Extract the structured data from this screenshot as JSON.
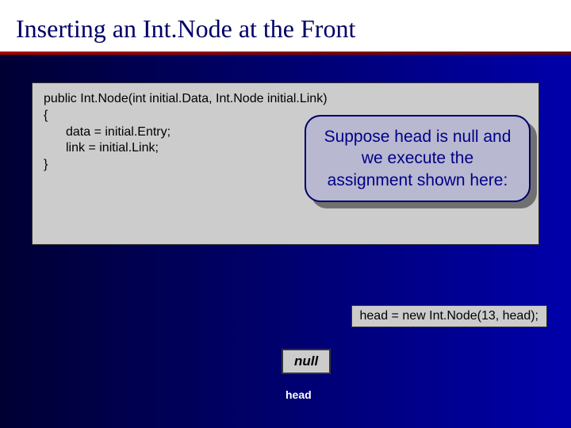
{
  "title": "Inserting an Int.Node at the Front",
  "code": {
    "line1": "public Int.Node(int initial.Data, Int.Node initial.Link)",
    "line2": "{",
    "line3": "data = initial.Entry;",
    "line4": "link = initial.Link;",
    "line5": "}"
  },
  "callout": "Suppose head is null and we execute the assignment shown here:",
  "assignment": "head = new Int.Node(13, head);",
  "nullLabel": "null",
  "headLabel": "head"
}
